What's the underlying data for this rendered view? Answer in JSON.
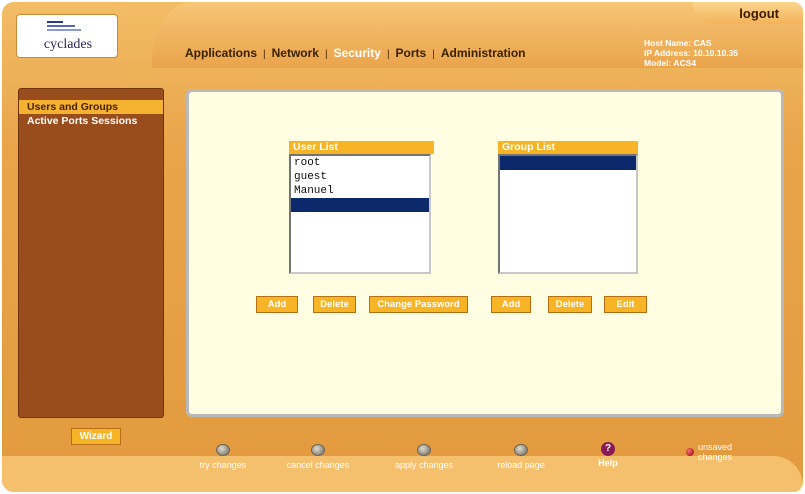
{
  "header": {
    "logo_text": "cyclades",
    "logout": "logout",
    "menu": [
      "Applications",
      "Network",
      "Security",
      "Ports",
      "Administration"
    ],
    "active_menu": "Security",
    "host_name": "Host Name: CAS",
    "ip_address": "IP Address: 10.10.10.35",
    "model": "Model: ACS4"
  },
  "sidebar": {
    "items": [
      {
        "label": "Users and Groups",
        "selected": true
      },
      {
        "label": "Active Ports Sessions",
        "selected": false
      }
    ],
    "wizard_label": "Wizard"
  },
  "user_list": {
    "title": "User List",
    "items": [
      "root",
      "guest",
      "Manuel",
      ""
    ],
    "selected_index": 3
  },
  "group_list": {
    "title": "Group List",
    "items": [
      ""
    ],
    "selected_index": 0
  },
  "user_buttons": {
    "add": "Add",
    "delete": "Delete",
    "change_password": "Change Password"
  },
  "group_buttons": {
    "add": "Add",
    "delete": "Delete",
    "edit": "Edit"
  },
  "bottom": {
    "try_changes": "try changes",
    "cancel_changes": "cancel changes",
    "apply_changes": "apply changes",
    "reload_page": "reload page",
    "help": "Help",
    "unsaved_line1": "unsaved",
    "unsaved_line2": "changes"
  },
  "colors": {
    "frame": "#e9a44a",
    "sidebar": "#9a4d1c",
    "button": "#f6b426",
    "panel": "#fffde2",
    "selection": "#0c2a6b"
  }
}
